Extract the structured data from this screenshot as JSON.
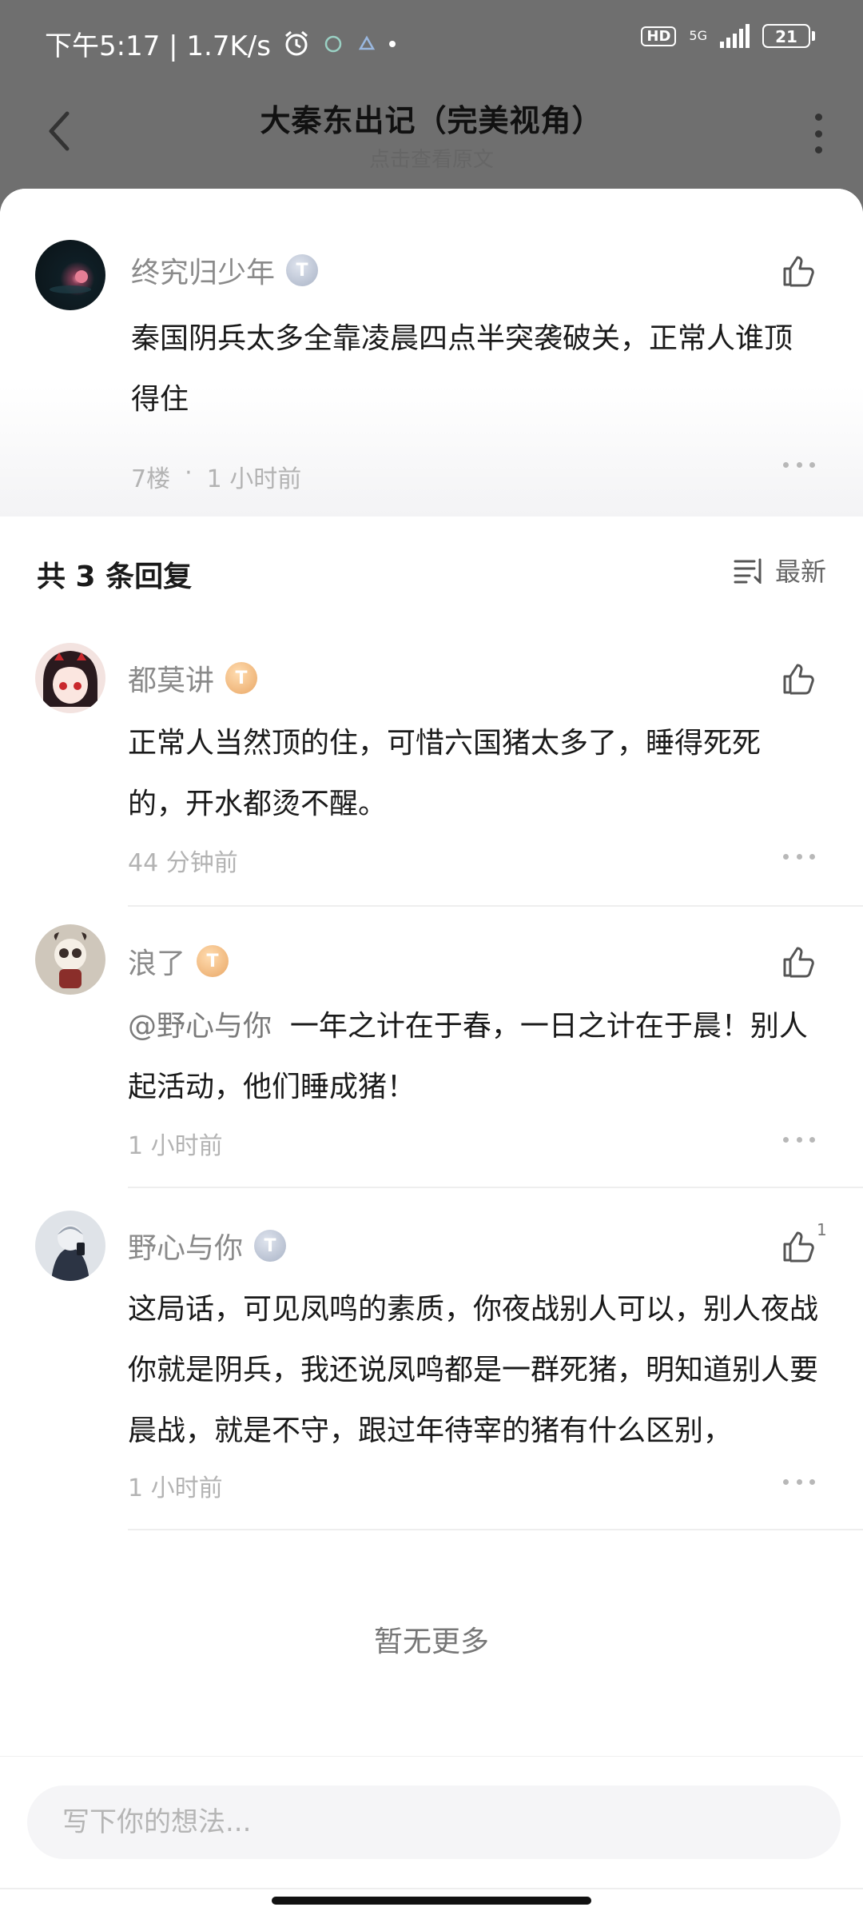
{
  "status_bar": {
    "time_speed": "下午5:17 | 1.7K/s",
    "hd_label": "HD",
    "network_label": "5G",
    "battery": "21"
  },
  "header": {
    "title": "大秦东出记（完美视角）",
    "subtitle": "点击查看原文"
  },
  "main_comment": {
    "username": "终究归少年",
    "badge": "T",
    "text": "秦国阴兵太多全靠凌晨四点半突袭破关，正常人谁顶得住",
    "floor": "7楼",
    "separator": "·",
    "time": "1 小时前"
  },
  "replies_header": {
    "count_label": "共 3 条回复",
    "sort_label": "最新"
  },
  "replies": [
    {
      "username": "都莫讲",
      "badge": "T",
      "text": "正常人当然顶的住，可惜六国猪太多了，睡得死死的，开水都烫不醒。",
      "mention": "",
      "time": "44 分钟前",
      "likes": ""
    },
    {
      "username": "浪了",
      "badge": "T",
      "mention": "@野心与你",
      "text": "一年之计在于春，一日之计在于晨！别人起活动，他们睡成猪！",
      "time": "1 小时前",
      "likes": ""
    },
    {
      "username": "野心与你",
      "badge": "T",
      "mention": "",
      "text": "这局话，可见凤鸣的素质，你夜战别人可以，别人夜战你就是阴兵，我还说凤鸣都是一群死猪，明知道别人要晨战，就是不守，跟过年待宰的猪有什么区别，",
      "time": "1 小时前",
      "likes": "1"
    }
  ],
  "footer": {
    "no_more": "暂无更多",
    "input_placeholder": "写下你的想法..."
  },
  "colors": {
    "overlay": "#6f6f6f",
    "text_primary": "#1a1a1a",
    "text_secondary": "#8a8a8a",
    "meta": "#b3b3b3"
  }
}
